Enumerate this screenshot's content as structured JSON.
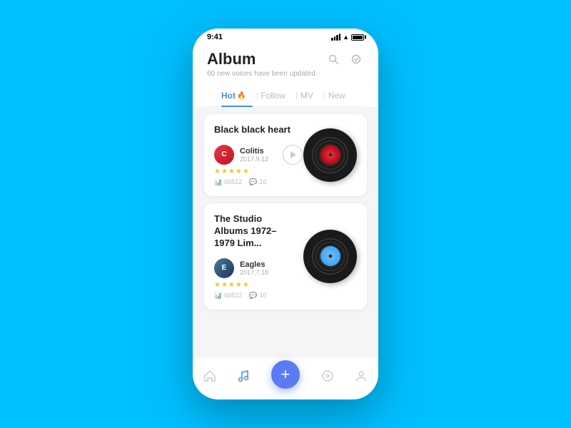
{
  "statusBar": {
    "time": "9:41"
  },
  "header": {
    "title": "Album",
    "subtitle": "60 new voices have been updated.",
    "searchIconLabel": "search",
    "checkIconLabel": "check-circle"
  },
  "tabs": [
    {
      "id": "hot",
      "label": "Hot",
      "active": true,
      "hasIcon": true
    },
    {
      "id": "follow",
      "label": "Follow",
      "active": false,
      "hasIcon": false
    },
    {
      "id": "mv",
      "label": "MV",
      "active": false,
      "hasIcon": false
    },
    {
      "id": "new",
      "label": "New",
      "active": false,
      "hasIcon": false
    }
  ],
  "albums": [
    {
      "id": "album-1",
      "title": "Black black heart",
      "artist": "Colitis",
      "date": "2017.9.12",
      "stars": "★★★★★",
      "plays": "60512",
      "comments": "10",
      "hasPlayBtn": true
    },
    {
      "id": "album-2",
      "title": "The Studio Albums 1972–1979 Lim...",
      "artist": "Eagles",
      "date": "2017.7.18",
      "stars": "★★★★★",
      "plays": "60512",
      "comments": "10",
      "hasPlayBtn": false
    }
  ],
  "bottomNav": {
    "fabLabel": "+",
    "items": [
      {
        "id": "home",
        "icon": "⌂",
        "active": false
      },
      {
        "id": "music",
        "icon": "♪",
        "active": true
      },
      {
        "id": "discover",
        "icon": "◎",
        "active": false
      },
      {
        "id": "profile",
        "icon": "👤",
        "active": false
      }
    ]
  }
}
